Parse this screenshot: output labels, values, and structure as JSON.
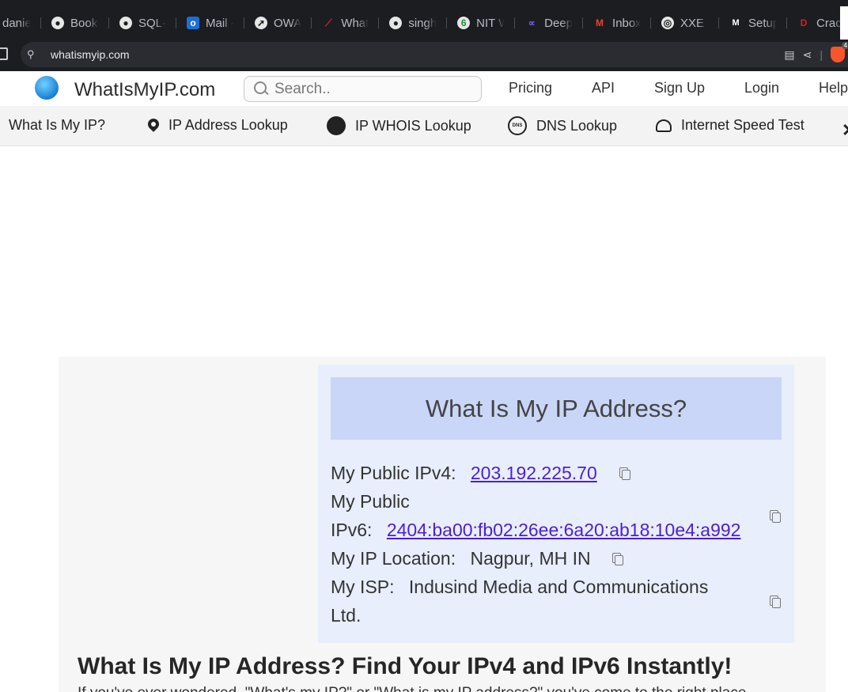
{
  "browser": {
    "bookmarks": [
      {
        "label": "danie",
        "icon": "generic-icon"
      },
      {
        "label": "Books",
        "icon": "github-icon"
      },
      {
        "label": "SQL-",
        "icon": "github-icon"
      },
      {
        "label": "Mail -",
        "icon": "outlook-icon"
      },
      {
        "label": "OWA",
        "icon": "owa-icon"
      },
      {
        "label": "What",
        "icon": "swoosh-icon"
      },
      {
        "label": "singh",
        "icon": "github-icon"
      },
      {
        "label": "NIT W",
        "icon": "nitw-icon"
      },
      {
        "label": "Deep",
        "icon": "deep-icon"
      },
      {
        "label": "Inbox",
        "icon": "gmail-icon"
      },
      {
        "label": "XXE I",
        "icon": "xxe-icon"
      },
      {
        "label": "Setup",
        "icon": "medium-icon"
      },
      {
        "label": "Crack",
        "icon": "d-icon"
      }
    ],
    "url": "whatismyip.com",
    "shield_badge": "4"
  },
  "site": {
    "logo_text": "WhatIsMyIP.com",
    "search_placeholder": "Search..",
    "nav": {
      "pricing": "Pricing",
      "api": "API",
      "signup": "Sign Up",
      "login": "Login",
      "help": "Help"
    },
    "subnav": {
      "what_is_my_ip": "What Is My IP?",
      "ip_lookup": "IP Address Lookup",
      "whois": "IP WHOIS Lookup",
      "dns": "DNS Lookup",
      "speed": "Internet Speed Test"
    }
  },
  "ip_card": {
    "title": "What Is My IP Address?",
    "ipv4_label": "My Public IPv4:",
    "ipv4_value": "203.192.225.70",
    "ipv6_label_line1": "My Public",
    "ipv6_label_line2": "IPv6:",
    "ipv6_value": "2404:ba00:fb02:26ee:6a20:ab18:10e4:a992",
    "location_label": "My IP Location:",
    "location_value": "Nagpur, MH IN",
    "isp_label": "My ISP:",
    "isp_value_line1": "Indusind Media and Communications",
    "isp_value_line2": "Ltd."
  },
  "article": {
    "heading": "What Is My IP Address? Find Your IPv4 and IPv6 Instantly!",
    "intro": "If you've ever wondered, \"What's my IP?\" or \"What is my IP address?\" you've come to the right place"
  },
  "colors": {
    "browser_chrome": "#1c1d21",
    "card_bg": "#e8eefc",
    "card_header": "#c9d6f7",
    "link": "#4b1fd6"
  }
}
